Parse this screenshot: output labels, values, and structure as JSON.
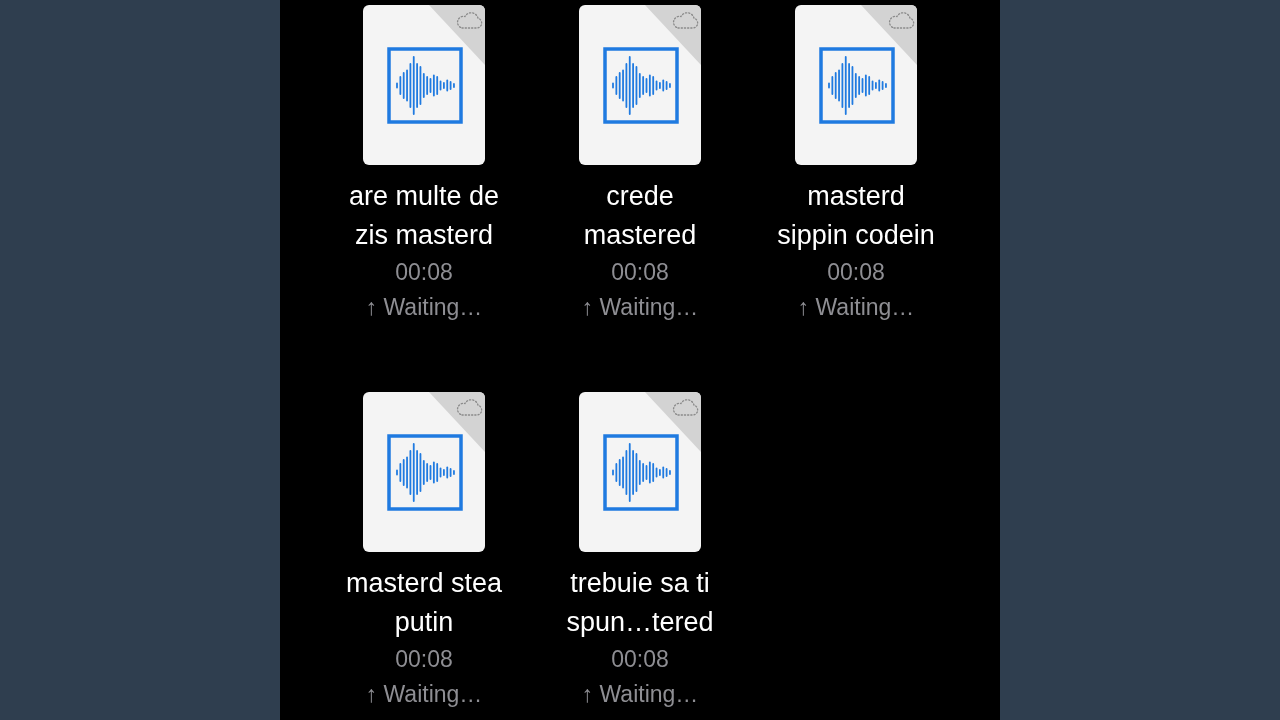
{
  "files": [
    {
      "name_lines": [
        "are multe de",
        "zis masterd"
      ],
      "duration": "00:08",
      "status": "↑ Waiting…"
    },
    {
      "name_lines": [
        "crede",
        "mastered"
      ],
      "duration": "00:08",
      "status": "↑ Waiting…"
    },
    {
      "name_lines": [
        "masterd",
        "sippin codein"
      ],
      "duration": "00:08",
      "status": "↑ Waiting…"
    },
    {
      "name_lines": [
        "masterd stea",
        "putin"
      ],
      "duration": "00:08",
      "status": "↑ Waiting…"
    },
    {
      "name_lines": [
        "trebuie sa ti",
        "spun…tered"
      ],
      "duration": "00:08",
      "status": "↑ Waiting…"
    }
  ]
}
